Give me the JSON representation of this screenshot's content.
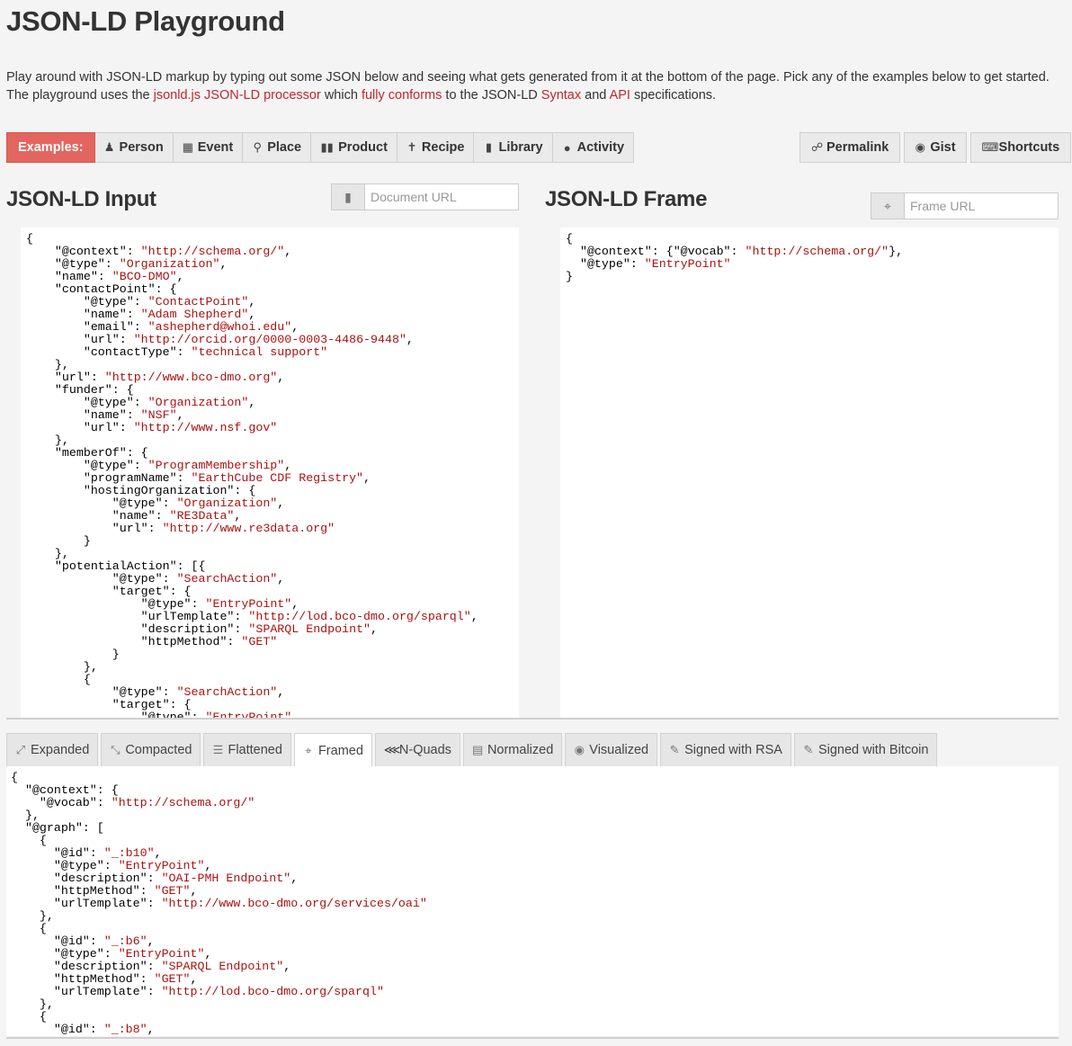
{
  "page": {
    "title": "JSON-LD Playground",
    "intro": {
      "t1": "Play around with JSON-LD markup by typing out some JSON below and seeing what gets generated from it at the bottom of the page. Pick any of the examples below to get started. The playground uses the ",
      "l1": "jsonld.js JSON-LD processor",
      "t2": " which ",
      "l2": "fully conforms",
      "t3": " to the JSON-LD ",
      "l3": "Syntax",
      "t4": " and ",
      "l4": "API",
      "t5": " specifications."
    }
  },
  "examples": {
    "label": "Examples:",
    "items": [
      {
        "label": "Person",
        "icon": "user-icon"
      },
      {
        "label": "Event",
        "icon": "calendar-icon"
      },
      {
        "label": "Place",
        "icon": "map-marker-icon"
      },
      {
        "label": "Product",
        "icon": "barcode-icon"
      },
      {
        "label": "Recipe",
        "icon": "cutlery-icon"
      },
      {
        "label": "Library",
        "icon": "book-icon"
      },
      {
        "label": "Activity",
        "icon": "comment-icon"
      }
    ]
  },
  "actions": {
    "permalink": "Permalink",
    "gist": "Gist",
    "shortcuts": "Shortcuts"
  },
  "input": {
    "heading": "JSON-LD Input",
    "url_placeholder": "Document URL"
  },
  "frame": {
    "heading": "JSON-LD Frame",
    "url_placeholder": "Frame URL"
  },
  "input_code": "{\n    \"@context\": \"http://schema.org/\",\n    \"@type\": \"Organization\",\n    \"name\": \"BCO-DMO\",\n    \"contactPoint\": {\n        \"@type\": \"ContactPoint\",\n        \"name\": \"Adam Shepherd\",\n        \"email\": \"ashepherd@whoi.edu\",\n        \"url\": \"http://orcid.org/0000-0003-4486-9448\",\n        \"contactType\": \"technical support\"\n    },\n    \"url\": \"http://www.bco-dmo.org\",\n    \"funder\": {\n        \"@type\": \"Organization\",\n        \"name\": \"NSF\",\n        \"url\": \"http://www.nsf.gov\"\n    },\n    \"memberOf\": {\n        \"@type\": \"ProgramMembership\",\n        \"programName\": \"EarthCube CDF Registry\",\n        \"hostingOrganization\": {\n            \"@type\": \"Organization\",\n            \"name\": \"RE3Data\",\n            \"url\": \"http://www.re3data.org\"\n        }\n    },\n    \"potentialAction\": [{\n            \"@type\": \"SearchAction\",\n            \"target\": {\n                \"@type\": \"EntryPoint\",\n                \"urlTemplate\": \"http://lod.bco-dmo.org/sparql\",\n                \"description\": \"SPARQL Endpoint\",\n                \"httpMethod\": \"GET\"\n            }\n        },\n        {\n            \"@type\": \"SearchAction\",\n            \"target\": {\n                \"@type\": \"EntryPoint\",",
  "frame_code": "{\n  \"@context\": {\"@vocab\": \"http://schema.org/\"},\n  \"@type\": \"EntryPoint\"\n}",
  "tabs": [
    {
      "label": "Expanded",
      "icon": "expand-icon",
      "active": false
    },
    {
      "label": "Compacted",
      "icon": "compress-icon",
      "active": false
    },
    {
      "label": "Flattened",
      "icon": "list-icon",
      "active": false
    },
    {
      "label": "Framed",
      "icon": "crop-icon",
      "active": true
    },
    {
      "label": "N-Quads",
      "icon": "share-alt-icon",
      "active": false
    },
    {
      "label": "Normalized",
      "icon": "archive-icon",
      "active": false
    },
    {
      "label": "Visualized",
      "icon": "eye-icon",
      "active": false
    },
    {
      "label": "Signed with RSA",
      "icon": "pencil-icon",
      "active": false
    },
    {
      "label": "Signed with Bitcoin",
      "icon": "pencil-icon",
      "active": false
    }
  ],
  "output_code": "{\n  \"@context\": {\n    \"@vocab\": \"http://schema.org/\"\n  },\n  \"@graph\": [\n    {\n      \"@id\": \"_:b10\",\n      \"@type\": \"EntryPoint\",\n      \"description\": \"OAI-PMH Endpoint\",\n      \"httpMethod\": \"GET\",\n      \"urlTemplate\": \"http://www.bco-dmo.org/services/oai\"\n    },\n    {\n      \"@id\": \"_:b6\",\n      \"@type\": \"EntryPoint\",\n      \"description\": \"SPARQL Endpoint\",\n      \"httpMethod\": \"GET\",\n      \"urlTemplate\": \"http://lod.bco-dmo.org/sparql\"\n    },\n    {\n      \"@id\": \"_:b8\","
}
